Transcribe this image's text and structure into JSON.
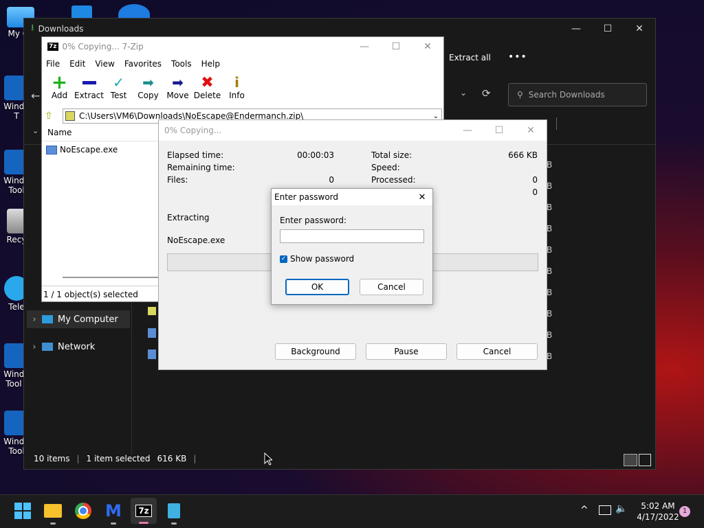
{
  "desktop": {
    "icons": [
      {
        "label": "My Co",
        "icon": "my-computer-icon"
      },
      {
        "label": "Windo\nT",
        "icon": "windows-tool-shortcut-icon"
      },
      {
        "label": "Windo\nTool",
        "icon": "windows-tool-shortcut-icon"
      },
      {
        "label": "Recy",
        "icon": "recycle-bin-icon"
      },
      {
        "label": "Tele",
        "icon": "telegram-icon"
      },
      {
        "label": "Windo\nTool -",
        "icon": "windows-tool-shortcut-icon"
      },
      {
        "label": "Windo\nTool",
        "icon": "windows-tool-shortcut-icon"
      }
    ]
  },
  "explorer": {
    "title": "Downloads",
    "extract_all": "Extract all",
    "more": "•••",
    "search_placeholder": "Search Downloads",
    "nav": [
      {
        "label": "My Computer",
        "selected": true
      },
      {
        "label": "Network",
        "selected": false
      }
    ],
    "list_fragment": "B",
    "status": {
      "count": "10 items",
      "selected": "1 item selected",
      "size": "616 KB"
    }
  },
  "sevenzip": {
    "title": "0% Copying... 7-Zip",
    "menu": [
      "File",
      "Edit",
      "View",
      "Favorites",
      "Tools",
      "Help"
    ],
    "toolbar": [
      "Add",
      "Extract",
      "Test",
      "Copy",
      "Move",
      "Delete",
      "Info"
    ],
    "path": "C:\\Users\\VM6\\Downloads\\NoEscape@Endermanch.zip\\",
    "column_name": "Name",
    "files": [
      "NoEscape.exe"
    ],
    "status": "1 / 1 object(s) selected"
  },
  "copying": {
    "title": "0% Copying...",
    "elapsed_label": "Elapsed time:",
    "elapsed": "00:00:03",
    "remaining_label": "Remaining time:",
    "files_label": "Files:",
    "files": "0",
    "total_label": "Total size:",
    "total": "666 KB",
    "speed_label": "Speed:",
    "processed_label": "Processed:",
    "processed": "0",
    "extra_value": "0",
    "action": "Extracting",
    "current_file": "NoEscape.exe",
    "buttons": {
      "background": "Background",
      "pause": "Pause",
      "cancel": "Cancel"
    }
  },
  "password": {
    "title": "Enter password",
    "label": "Enter password:",
    "value": "",
    "show_password": "Show password",
    "show_password_checked": true,
    "ok": "OK",
    "cancel": "Cancel"
  },
  "taskbar": {
    "apps": [
      "start-icon",
      "file-explorer-icon",
      "chrome-icon",
      "malwarebytes-icon",
      "7zip-icon",
      "notepad-icon"
    ],
    "time": "5:02 AM",
    "date": "4/17/2022",
    "notifications": "1"
  },
  "colors": {
    "accent": "#0067c0",
    "explorer_bg": "#191919"
  }
}
